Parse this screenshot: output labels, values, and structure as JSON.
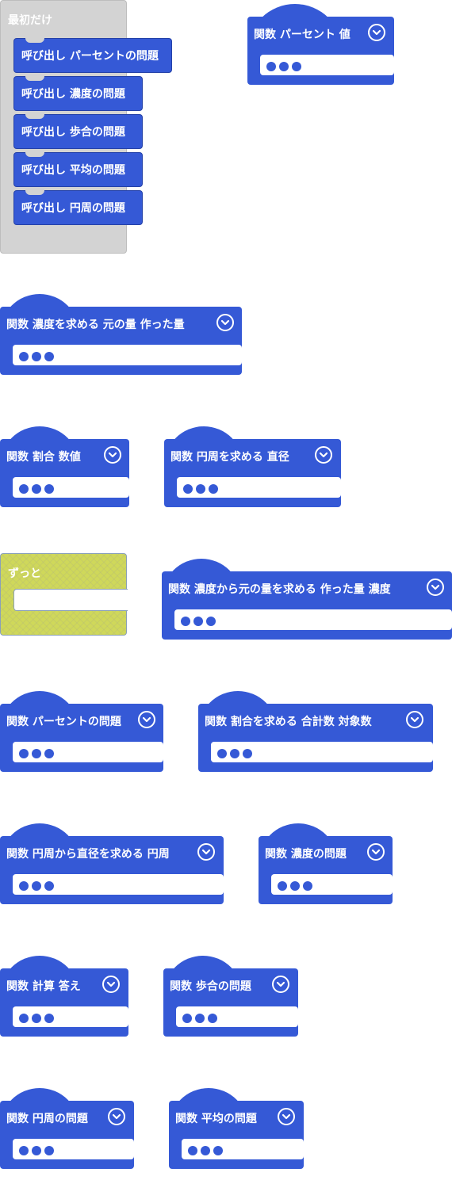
{
  "hat_block": {
    "title": "最初だけ",
    "calls": [
      "呼び出し パーセントの問題",
      "呼び出し 濃度の問題",
      "呼び出し 歩合の問題",
      "呼び出し 平均の問題",
      "呼び出し 円周の問題"
    ]
  },
  "forever_block": {
    "title": "ずっと"
  },
  "functions": [
    {
      "label": "関数 パーセント 値"
    },
    {
      "label": "関数 濃度を求める 元の量 作った量"
    },
    {
      "label": "関数 割合 数値"
    },
    {
      "label": "関数 円周を求める 直径"
    },
    {
      "label": "関数 濃度から元の量を求める 作った量 濃度"
    },
    {
      "label": "関数 パーセントの問題"
    },
    {
      "label": "関数 割合を求める 合計数 対象数"
    },
    {
      "label": "関数 円周から直径を求める 円周"
    },
    {
      "label": "関数 濃度の問題"
    },
    {
      "label": "関数 計算 答え"
    },
    {
      "label": "関数 歩合の問題"
    },
    {
      "label": "関数 円周の問題"
    },
    {
      "label": "関数 平均の問題"
    }
  ],
  "colors": {
    "block_blue": "#3559d6",
    "hat_gray": "#d3d3d3",
    "forever_yellow": "#cfd85a"
  },
  "icons": {
    "expand": "chevron-down-circle-icon",
    "params": "ellipsis-dots-icon"
  }
}
